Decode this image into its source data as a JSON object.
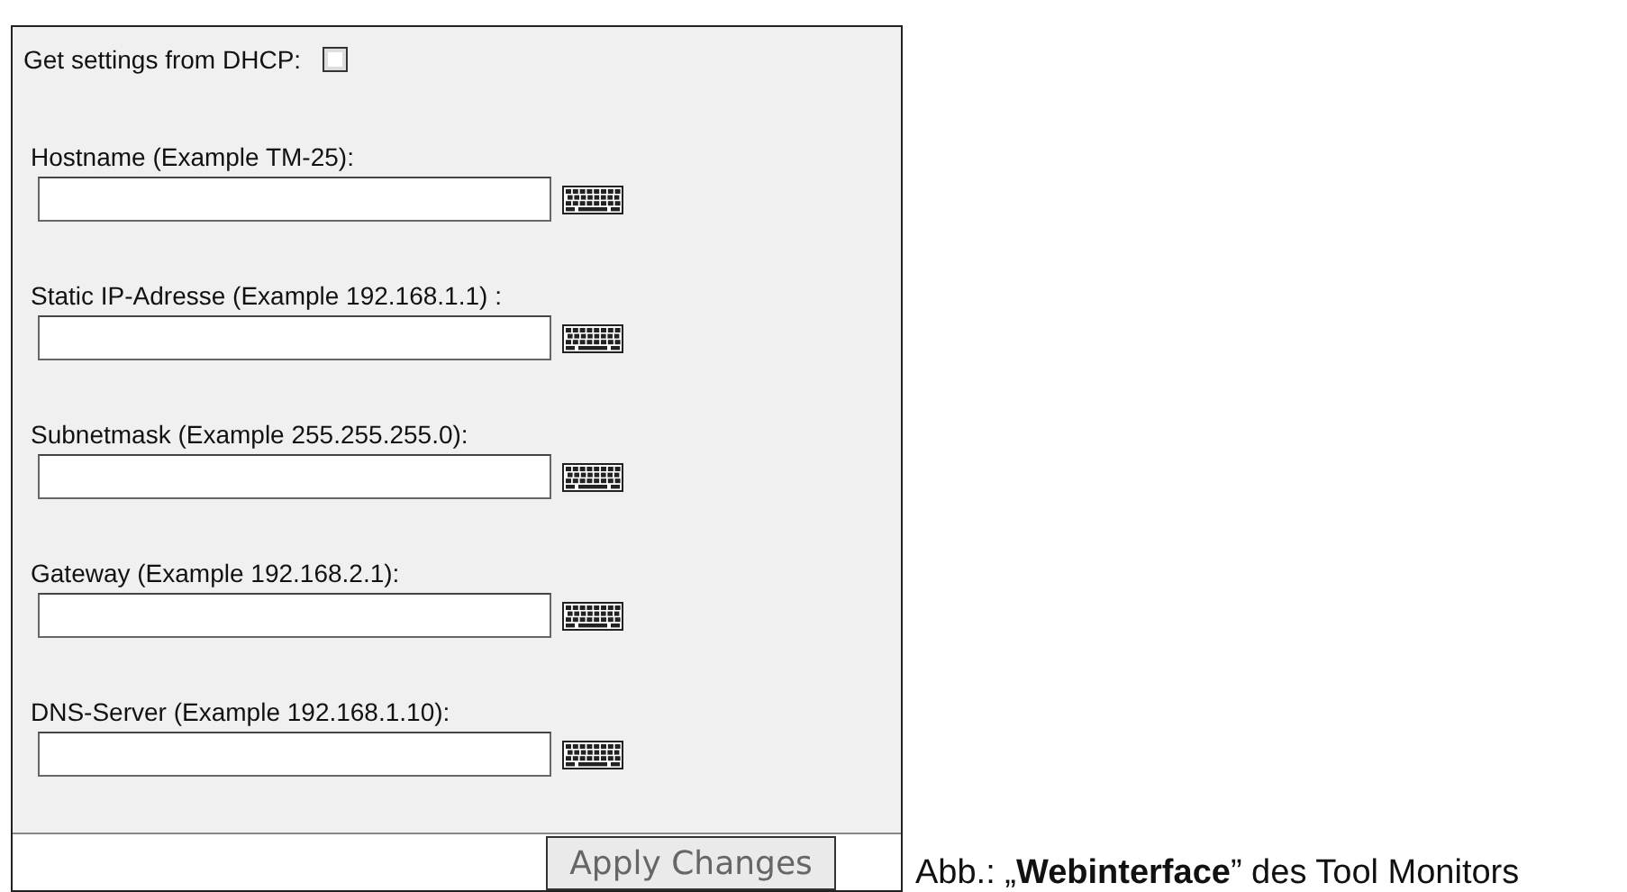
{
  "dhcp": {
    "label": "Get settings from DHCP:",
    "checked": false
  },
  "fields": [
    {
      "label": "Hostname (Example TM-25):"
    },
    {
      "label": "Static IP-Adresse (Example 192.168.1.1) :"
    },
    {
      "label": "Subnetmask (Example 255.255.255.0):"
    },
    {
      "label": "Gateway (Example 192.168.2.1):"
    },
    {
      "label": "DNS-Server (Example 192.168.1.10):"
    }
  ],
  "apply_button": "Apply Changes",
  "caption": "Abb.: „**Webinterface**” des Tool Monitors"
}
